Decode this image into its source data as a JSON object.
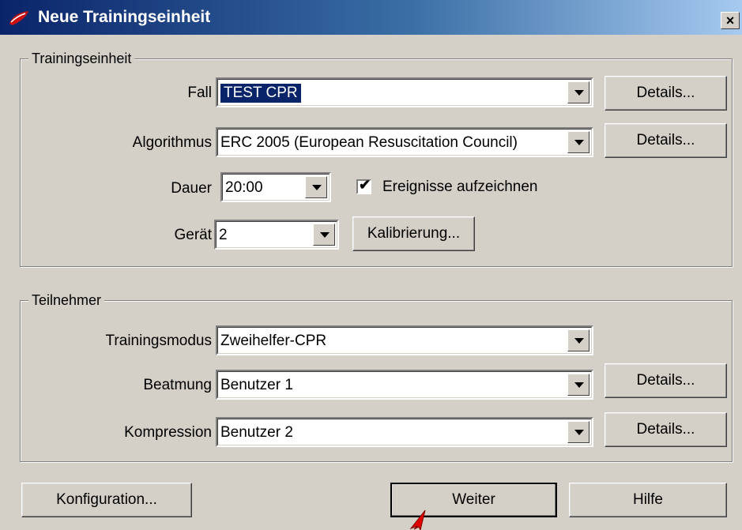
{
  "window": {
    "title": "Neue Trainingseinheit",
    "close_symbol": "×"
  },
  "training": {
    "legend": "Trainingseinheit",
    "fall": {
      "label": "Fall",
      "value": "TEST CPR",
      "details": "Details..."
    },
    "algorithmus": {
      "label": "Algorithmus",
      "value": "ERC 2005 (European Resuscitation Council)",
      "details": "Details..."
    },
    "dauer": {
      "label": "Dauer",
      "value": "20:00"
    },
    "ereignisse": {
      "label": "Ereignisse aufzeichnen",
      "checked": true,
      "mark": "✔"
    },
    "geraet": {
      "label": "Gerät",
      "value": "2",
      "kalibrierung": "Kalibrierung..."
    }
  },
  "participants": {
    "legend": "Teilnehmer",
    "modus": {
      "label": "Trainingsmodus",
      "value": "Zweihelfer-CPR"
    },
    "beatmung": {
      "label": "Beatmung",
      "value": "Benutzer 1",
      "details": "Details..."
    },
    "kompression": {
      "label": "Kompression",
      "value": "Benutzer 2",
      "details": "Details..."
    }
  },
  "footer": {
    "konfiguration": "Konfiguration...",
    "weiter": "Weiter",
    "hilfe": "Hilfe"
  },
  "colors": {
    "titlebar_start": "#0a246a",
    "titlebar_end": "#a6caf0",
    "face": "#d4d0c8",
    "selection": "#0a246a"
  }
}
